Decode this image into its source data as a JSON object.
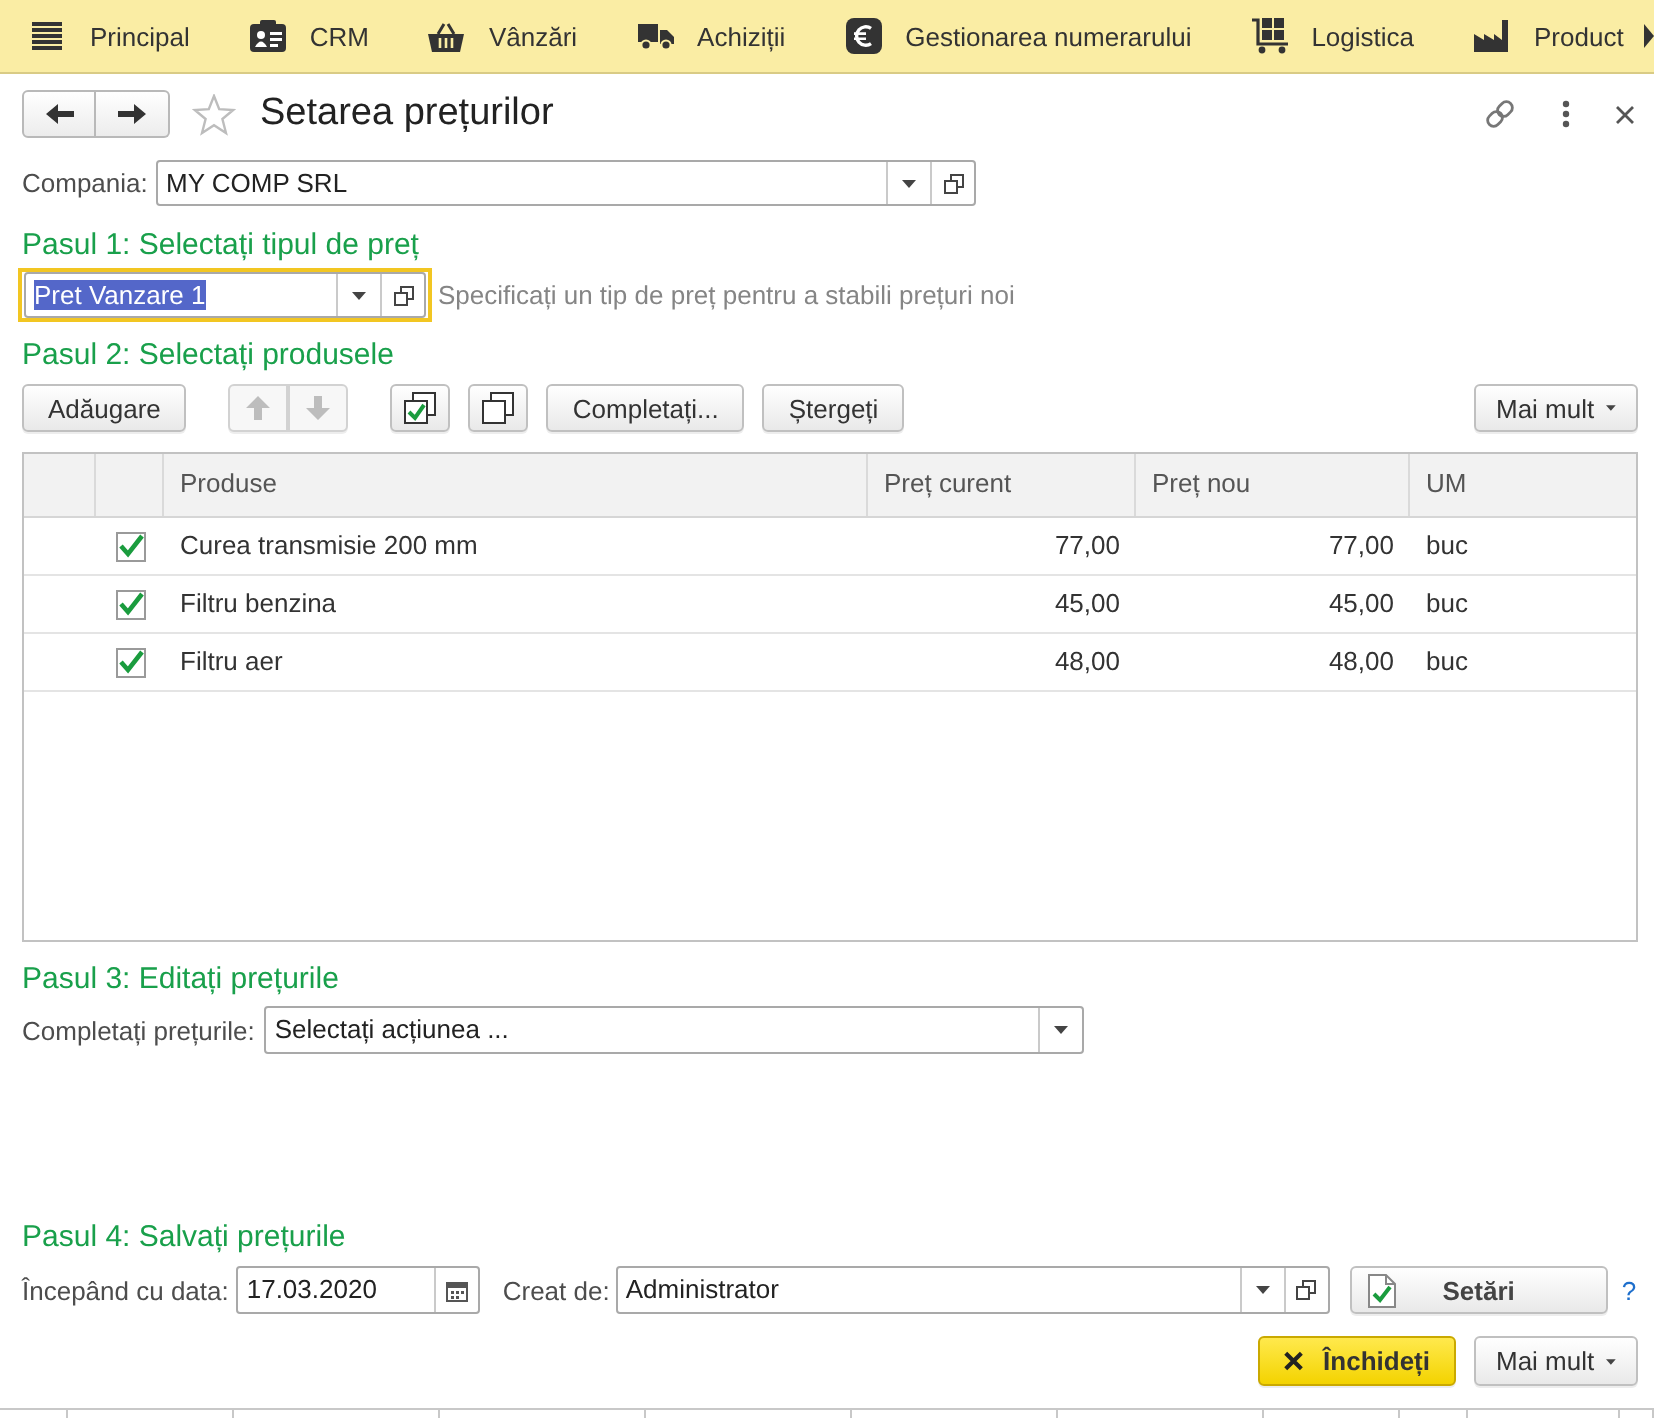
{
  "nav_menu": [
    {
      "label": "Principal"
    },
    {
      "label": "CRM"
    },
    {
      "label": "Vânzări"
    },
    {
      "label": "Achiziții"
    },
    {
      "label": "Gestionarea numerarului"
    },
    {
      "label": "Logistica"
    },
    {
      "label": "Product"
    }
  ],
  "window": {
    "title": "Setarea prețurilor",
    "favorite": false
  },
  "company": {
    "label": "Compania:",
    "value": "MY COMP SRL"
  },
  "step1": {
    "heading": "Pasul 1: Selectați tipul de preț",
    "price_type": {
      "value": "Pret Vanzare 1",
      "focused": true
    },
    "hint": "Specificați un tip de preț pentru a stabili prețuri noi"
  },
  "step2": {
    "heading": "Pasul 2: Selectați produsele",
    "toolbar": [
      {
        "kind": "text",
        "label": "Adăugare",
        "disabled": false
      },
      {
        "kind": "move_up",
        "disabled": true
      },
      {
        "kind": "move_down",
        "disabled": true
      },
      {
        "kind": "check_all",
        "disabled": false
      },
      {
        "kind": "uncheck_all",
        "disabled": false
      },
      {
        "kind": "text",
        "label": "Completați...",
        "disabled": false
      },
      {
        "kind": "text",
        "label": "Ștergeți",
        "disabled": false
      }
    ],
    "more_button": "Mai mult",
    "table": {
      "columns": [
        "Produse",
        "Preț curent",
        "Preț nou",
        "UM"
      ],
      "rows": [
        {
          "checked": true,
          "product": "Curea transmisie 200 mm",
          "current_price": "77,00",
          "new_price": "77,00",
          "unit": "buc"
        },
        {
          "checked": true,
          "product": "Filtru benzina",
          "current_price": "45,00",
          "new_price": "45,00",
          "unit": "buc"
        },
        {
          "checked": true,
          "product": "Filtru aer",
          "current_price": "48,00",
          "new_price": "48,00",
          "unit": "buc"
        }
      ]
    }
  },
  "step3": {
    "heading": "Pasul 3: Editați prețurile",
    "label": "Completați prețurile:",
    "action": "Selectați acțiunea ..."
  },
  "step4": {
    "heading": "Pasul 4: Salvați prețurile",
    "date_label": "Începând cu data:",
    "date": "17.03.2020",
    "author_label": "Creat de:",
    "author": "Administrator",
    "settings_button": "Setări",
    "help": "?"
  },
  "footer": {
    "close_button": "Închideți",
    "more_button": "Mai mult"
  }
}
